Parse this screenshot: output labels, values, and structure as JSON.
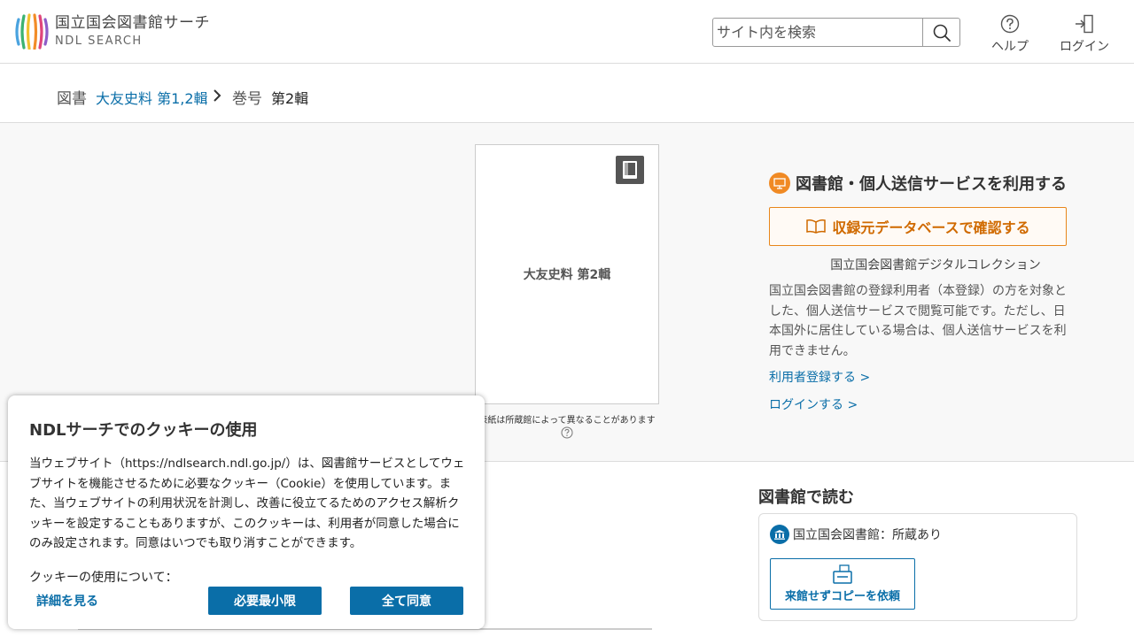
{
  "header": {
    "logo_ja": "国立国会図書館サーチ",
    "logo_en": "NDL SEARCH",
    "search_placeholder": "サイト内を検索",
    "help_label": "ヘルプ",
    "login_label": "ログイン"
  },
  "breadcrumb": {
    "type1": "図書",
    "link": "大友史料 第1,2輯",
    "type2": "巻号",
    "current": "第2輯"
  },
  "cover": {
    "title": "大友史料 第2輯",
    "note": "表紙は所蔵館によって異なることがあります"
  },
  "service": {
    "title": "図書館・個人送信サービスを利用する",
    "button": "収録元データベースで確認する",
    "source": "国立国会図書館デジタルコレクション",
    "description": "国立国会図書館の登録利用者（本登録）の方を対象とした、個人送信サービスで閲覧可能です。ただし、日本国外に居住している場合は、個人送信サービスを利用できません。",
    "register_link": "利用者登録する >",
    "login_link": "ログインする >"
  },
  "read": {
    "title": "図書館で読む",
    "library": "国立国会図書館：所蔵あり",
    "copy_button": "来館せずコピーを依頼"
  },
  "cookie": {
    "title": "NDLサーチでのクッキーの使用",
    "body": "当ウェブサイト（https://ndlsearch.ndl.go.jp/）は、図書館サービスとしてウェブサイトを機能させるために必要なクッキー（Cookie）を使用しています。また、当ウェブサイトの利用状況を計測し、改善に役立てるためのアクセス解析クッキーを設定することもありますが、このクッキーは、利用者が同意した場合にのみ設定されます。同意はいつでも取り消すことができます。",
    "about": "クッキーの使用について：",
    "detail_link": "詳細を見る",
    "minimal_button": "必要最小限",
    "accept_button": "全て同意"
  },
  "colors": {
    "link_blue": "#0a6ea8",
    "service_orange": "#e8861a"
  }
}
